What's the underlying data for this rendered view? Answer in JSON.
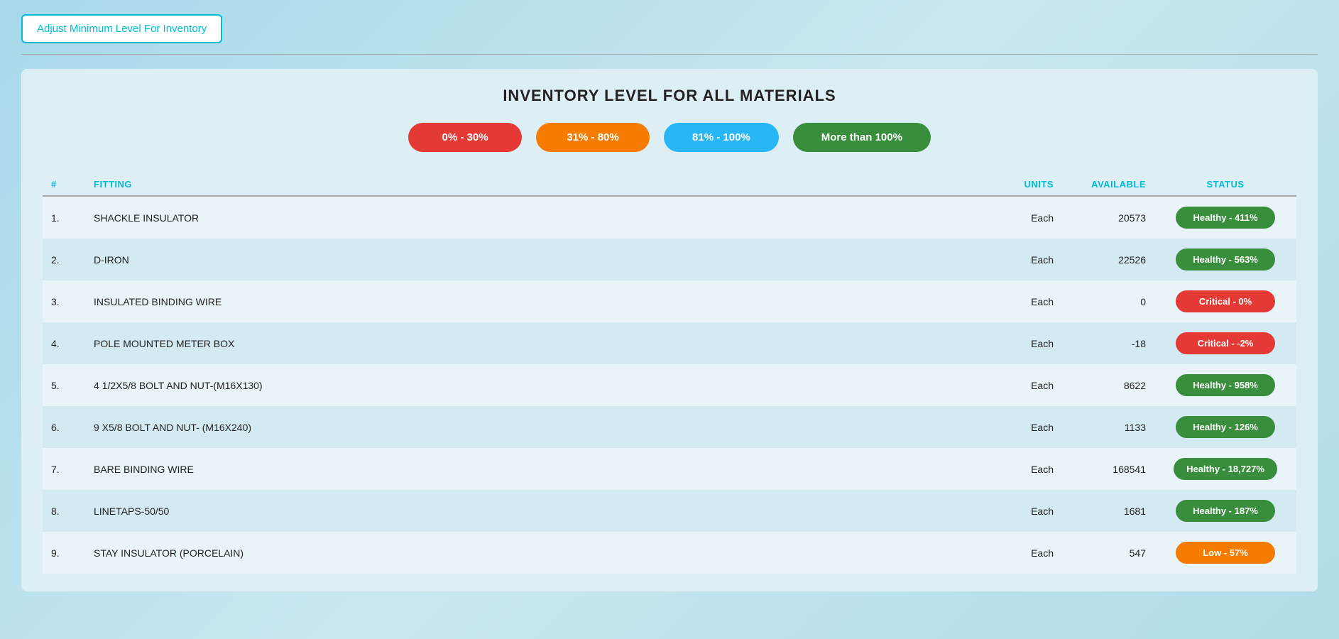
{
  "header": {
    "adjust_btn_label": "Adjust Minimum Level For Inventory"
  },
  "page": {
    "title": "INVENTORY LEVEL FOR ALL MATERIALS"
  },
  "legend": [
    {
      "id": "legend-0-30",
      "label": "0% - 30%",
      "color_class": "legend-red"
    },
    {
      "id": "legend-31-80",
      "label": "31% - 80%",
      "color_class": "legend-orange"
    },
    {
      "id": "legend-81-100",
      "label": "81% - 100%",
      "color_class": "legend-blue"
    },
    {
      "id": "legend-100plus",
      "label": "More than 100%",
      "color_class": "legend-green"
    }
  ],
  "table": {
    "columns": [
      {
        "key": "num",
        "label": "#"
      },
      {
        "key": "fitting",
        "label": "FITTING"
      },
      {
        "key": "units",
        "label": "UNITS"
      },
      {
        "key": "available",
        "label": "AVAILABLE"
      },
      {
        "key": "status",
        "label": "STATUS"
      }
    ],
    "rows": [
      {
        "num": "1.",
        "fitting": "SHACKLE INSULATOR",
        "units": "Each",
        "available": "20573",
        "status": "Healthy - 411%",
        "status_class": "status-healthy"
      },
      {
        "num": "2.",
        "fitting": "D-IRON",
        "units": "Each",
        "available": "22526",
        "status": "Healthy - 563%",
        "status_class": "status-healthy"
      },
      {
        "num": "3.",
        "fitting": "INSULATED BINDING WIRE",
        "units": "Each",
        "available": "0",
        "status": "Critical - 0%",
        "status_class": "status-critical"
      },
      {
        "num": "4.",
        "fitting": "POLE MOUNTED METER BOX",
        "units": "Each",
        "available": "-18",
        "status": "Critical - -2%",
        "status_class": "status-critical"
      },
      {
        "num": "5.",
        "fitting": "4 1/2X5/8 BOLT AND NUT-(M16X130)",
        "units": "Each",
        "available": "8622",
        "status": "Healthy - 958%",
        "status_class": "status-healthy"
      },
      {
        "num": "6.",
        "fitting": "9 X5/8 BOLT AND NUT- (M16X240)",
        "units": "Each",
        "available": "1133",
        "status": "Healthy - 126%",
        "status_class": "status-healthy"
      },
      {
        "num": "7.",
        "fitting": "BARE BINDING WIRE",
        "units": "Each",
        "available": "168541",
        "status": "Healthy - 18,727%",
        "status_class": "status-healthy"
      },
      {
        "num": "8.",
        "fitting": "LINETAPS-50/50",
        "units": "Each",
        "available": "1681",
        "status": "Healthy - 187%",
        "status_class": "status-healthy"
      },
      {
        "num": "9.",
        "fitting": "STAY INSULATOR (PORCELAIN)",
        "units": "Each",
        "available": "547",
        "status": "Low - 57%",
        "status_class": "status-low"
      }
    ]
  }
}
